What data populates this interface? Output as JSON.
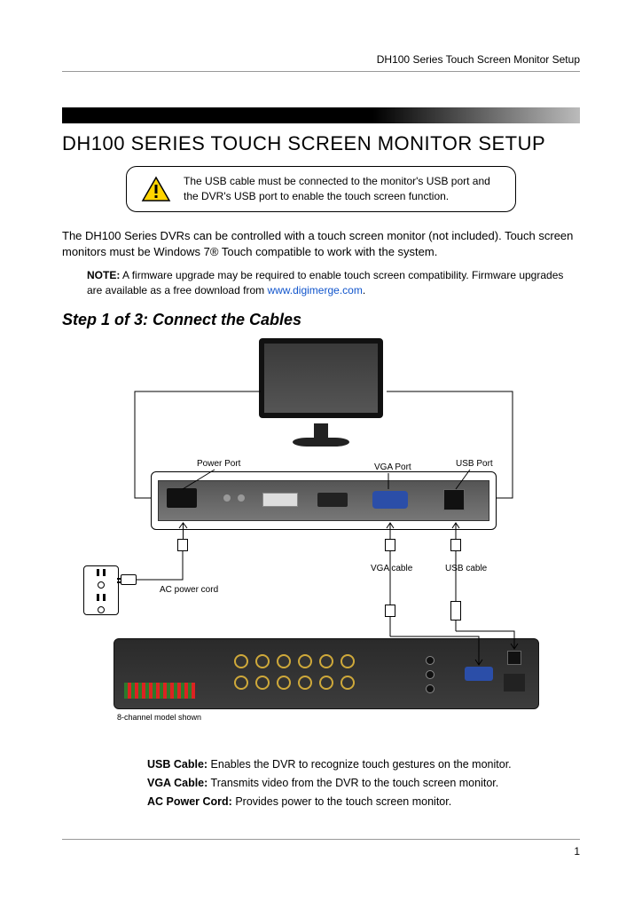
{
  "header": {
    "running_title": "DH100 Series Touch Screen Monitor Setup"
  },
  "title": "DH100 SERIES TOUCH SCREEN MONITOR SETUP",
  "callout": {
    "text": "The USB cable must be connected to the monitor's USB port and the DVR's USB port to enable the touch screen function."
  },
  "intro": "The DH100 Series DVRs can be controlled with a touch screen monitor (not included). Touch screen monitors must be Windows 7® Touch compatible to work with the system.",
  "note": {
    "label": "NOTE:",
    "text": " A firmware upgrade may be required to enable touch screen compatibility. Firmware upgrades are available as a free download from ",
    "link_text": "www.digimerge.com",
    "link_after": "."
  },
  "step_heading": "Step 1 of 3: Connect the Cables",
  "diagram_labels": {
    "power_port": "Power Port",
    "vga_port": "VGA Port",
    "usb_port": "USB Port",
    "vga_cable": "VGA cable",
    "usb_cable": "USB cable",
    "ac_power_cord": "AC power cord",
    "model_caption": "8-channel model shown"
  },
  "descriptions": {
    "usb_label": "USB Cable:",
    "usb_text": " Enables the DVR to recognize touch gestures on the monitor.",
    "vga_label": "VGA Cable:",
    "vga_text": " Transmits video from the DVR to the touch screen monitor.",
    "ac_label": "AC Power Cord:",
    "ac_text": " Provides power to the touch screen monitor."
  },
  "page_number": "1"
}
